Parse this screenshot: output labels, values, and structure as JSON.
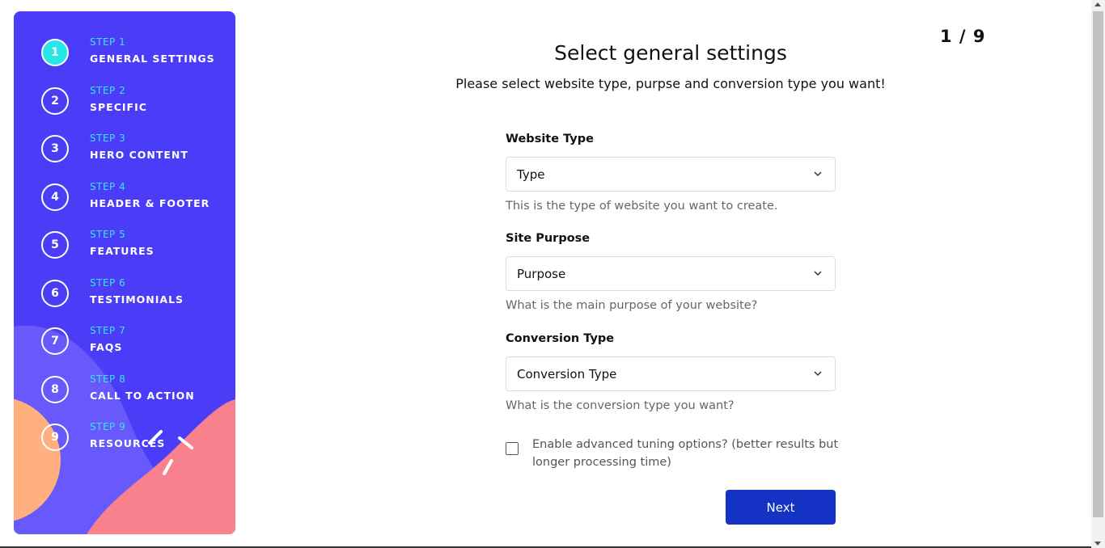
{
  "sidebar": {
    "steps": [
      {
        "number": "1",
        "label": "STEP 1",
        "title": "GENERAL SETTINGS"
      },
      {
        "number": "2",
        "label": "STEP 2",
        "title": "SPECIFIC"
      },
      {
        "number": "3",
        "label": "STEP 3",
        "title": "HERO CONTENT"
      },
      {
        "number": "4",
        "label": "STEP 4",
        "title": "HEADER & FOOTER"
      },
      {
        "number": "5",
        "label": "STEP 5",
        "title": "FEATURES"
      },
      {
        "number": "6",
        "label": "STEP 6",
        "title": "TESTIMONIALS"
      },
      {
        "number": "7",
        "label": "STEP 7",
        "title": "FAQS"
      },
      {
        "number": "8",
        "label": "STEP 8",
        "title": "CALL TO ACTION"
      },
      {
        "number": "9",
        "label": "STEP 9",
        "title": "RESOURCES"
      }
    ],
    "colors": {
      "background": "#4b3df7",
      "active": "#27e6e9",
      "step_label": "#3de3ea"
    }
  },
  "page": {
    "counter": "1 / 9",
    "title": "Select general settings",
    "subtitle": "Please select website type, purpse and conversion type you want!"
  },
  "form": {
    "website_type": {
      "label": "Website Type",
      "value": "Type",
      "help": "This is the type of website you want to create."
    },
    "site_purpose": {
      "label": "Site Purpose",
      "value": "Purpose",
      "help": "What is the main purpose of your website?"
    },
    "conversion_type": {
      "label": "Conversion Type",
      "value": "Conversion Type",
      "help": "What is the conversion type you want?"
    },
    "advanced": {
      "label": "Enable advanced tuning options? (better results but longer processing time)",
      "checked": false
    },
    "next_label": "Next"
  },
  "colors": {
    "primary_button": "#1433c4"
  }
}
